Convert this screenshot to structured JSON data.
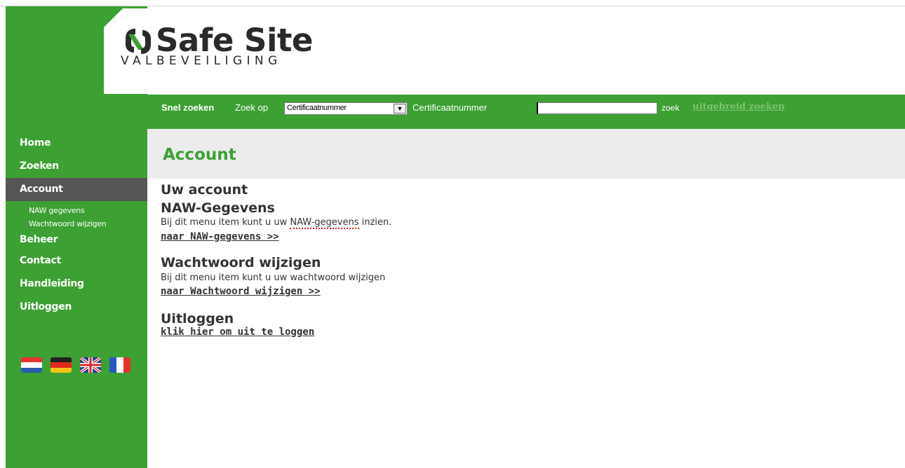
{
  "logo": {
    "title": "Safe Site",
    "subtitle": "VALBEVEILIGING"
  },
  "search": {
    "quick_label": "Snel zoeken",
    "by_label": "Zoek op",
    "select_value": "Certificaatnummer",
    "field_label": "Certificaatnummer",
    "input_value": "",
    "search_button": "zoek",
    "advanced_link": "uitgebreid zoeken"
  },
  "page": {
    "title": "Account"
  },
  "sidebar": {
    "items": [
      {
        "label": "Home"
      },
      {
        "label": "Zoeken"
      },
      {
        "label": "Account",
        "active": true
      },
      {
        "label": "Beheer"
      },
      {
        "label": "Contact"
      },
      {
        "label": "Handleiding"
      },
      {
        "label": "Uitloggen"
      }
    ],
    "subitems": [
      {
        "label": "NAW gegevens"
      },
      {
        "label": "Wachtwoord wijzigen"
      }
    ]
  },
  "languages": [
    {
      "icon": "flag-nl-icon"
    },
    {
      "icon": "flag-de-icon"
    },
    {
      "icon": "flag-uk-icon"
    },
    {
      "icon": "flag-fr-icon"
    }
  ],
  "content": {
    "heading": "Uw account",
    "sections": [
      {
        "title": "NAW-Gegevens",
        "desc_pre": "Bij dit menu item kunt u uw ",
        "desc_spell": "NAW-gegevens",
        "desc_post": " inzien.",
        "link": "naar NAW-gegevens >>"
      },
      {
        "title": "Wachtwoord wijzigen",
        "desc": "Bij dit menu item kunt u uw wachtwoord wijzigen",
        "link": "naar Wachtwoord wijzigen >>"
      },
      {
        "title": "Uitloggen",
        "link": "klik hier om uit te loggen"
      }
    ]
  },
  "colors": {
    "brand_green": "#3ca033",
    "active_nav": "#555555",
    "title_band": "#ececec",
    "text": "#333333"
  }
}
